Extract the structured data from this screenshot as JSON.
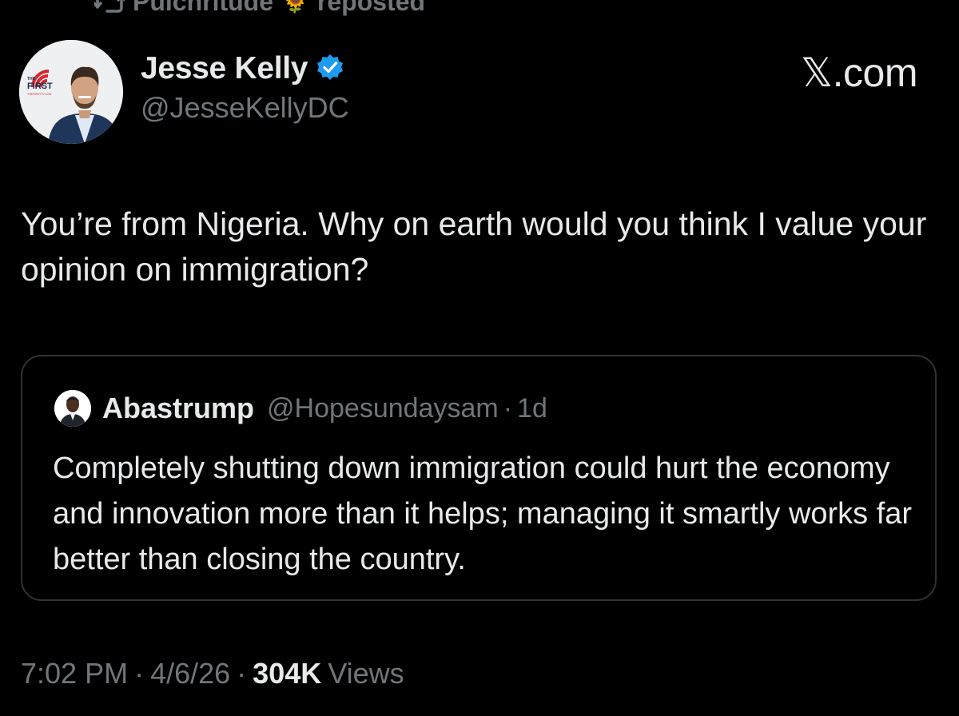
{
  "repost": {
    "user": "Pulchritude",
    "emoji": "🌻",
    "label": "reposted"
  },
  "author": {
    "name": "Jesse Kelly",
    "handle": "@JesseKellyDC",
    "verified": true,
    "avatar_logo_top": "THE",
    "avatar_logo_main": "FIRST",
    "avatar_logo_sub": "THEFIRSTTV.COM"
  },
  "brand": "𝕏.com",
  "tweet": {
    "text": "You’re from Nigeria. Why on earth would you think I value your opinion on immigration?"
  },
  "quote": {
    "name": "Abastrump",
    "handle": "@Hopesundaysam",
    "separator": "·",
    "time": "1d",
    "text": "Completely shutting down immigration could hurt the economy and innovation more than it helps; managing it smartly works far better than closing the country."
  },
  "meta": {
    "time": "7:02 PM",
    "date": "4/6/26",
    "separator": "·",
    "views_count": "304K",
    "views_label": "Views"
  },
  "colors": {
    "background": "#000000",
    "text_primary": "#e7e9ea",
    "text_secondary": "#71767b",
    "border": "#2f3336",
    "verified_badge": "#1d9bf0",
    "logo_red": "#d6262c",
    "logo_navy": "#1b2a52"
  },
  "icons": {
    "repost": "repost-icon",
    "verified": "verified-badge-icon"
  }
}
